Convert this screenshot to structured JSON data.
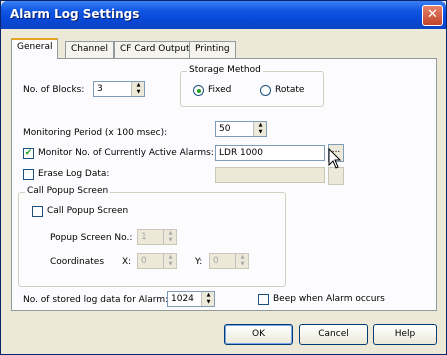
{
  "window": {
    "title": "Alarm Log Settings",
    "close_glyph": "✕"
  },
  "tabs": [
    {
      "label": "General",
      "active": true
    },
    {
      "label": "Channel",
      "active": false
    },
    {
      "label": "CF Card Output",
      "active": false
    },
    {
      "label": "Printing",
      "active": false
    }
  ],
  "blocks": {
    "label": "No. of Blocks:",
    "value": "3"
  },
  "storage": {
    "group_label": "Storage Method",
    "fixed_label": "Fixed",
    "rotate_label": "Rotate",
    "selected": "Fixed"
  },
  "monitoring": {
    "label": "Monitoring Period (x 100 msec):",
    "value": "50"
  },
  "monitor_active": {
    "label": "Monitor No. of Currently Active Alarms:",
    "checked": true,
    "value": "LDR 1000",
    "button": "..."
  },
  "erase_log": {
    "label": "Erase Log Data:",
    "checked": false,
    "value": ""
  },
  "call_popup": {
    "group_label": "Call Popup Screen",
    "checkbox_label": "Call Popup Screen",
    "checked": false,
    "screen_no_label": "Popup Screen No.:",
    "screen_no_value": "1",
    "coords_label": "Coordinates",
    "x_label": "X:",
    "x_value": "0",
    "y_label": "Y:",
    "y_value": "0"
  },
  "stored": {
    "label": "No. of stored log data for Alarm:",
    "value": "1024"
  },
  "beep": {
    "label": "Beep when Alarm occurs",
    "checked": false
  },
  "buttons": {
    "ok": "OK",
    "cancel": "Cancel",
    "help": "Help"
  }
}
